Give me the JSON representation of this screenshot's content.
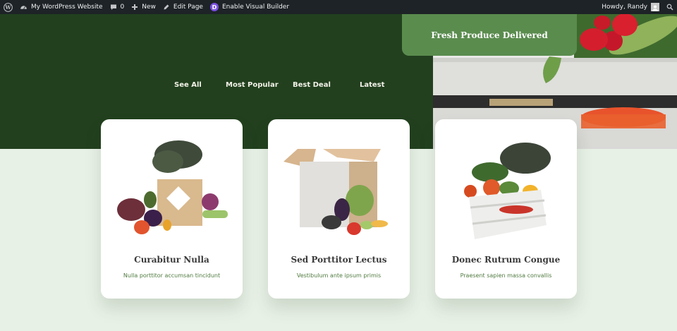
{
  "admin_bar": {
    "site_name": "My WordPress Website",
    "comments_count": "0",
    "new_label": "New",
    "edit_label": "Edit Page",
    "visual_builder_label": "Enable Visual Builder",
    "divi_letter": "D",
    "greeting": "Howdy, Randy"
  },
  "hero": {
    "cta_label": "Fresh Produce Delivered",
    "filters": [
      "See All",
      "Most Popular",
      "Best Deal",
      "Latest"
    ]
  },
  "products": [
    {
      "title": "Curabitur Nulla",
      "subtitle": "Nulla porttitor accumsan tincidunt"
    },
    {
      "title": "Sed Porttitor Lectus",
      "subtitle": "Vestibulum ante ipsum primis"
    },
    {
      "title": "Donec Rutrum Congue",
      "subtitle": "Praesent sapien massa convallis"
    }
  ],
  "colors": {
    "hero_dark": "#22401e",
    "accent_green": "#5a8c4e",
    "page_bg": "#e8f1e6",
    "admin_bar": "#1d2327"
  }
}
